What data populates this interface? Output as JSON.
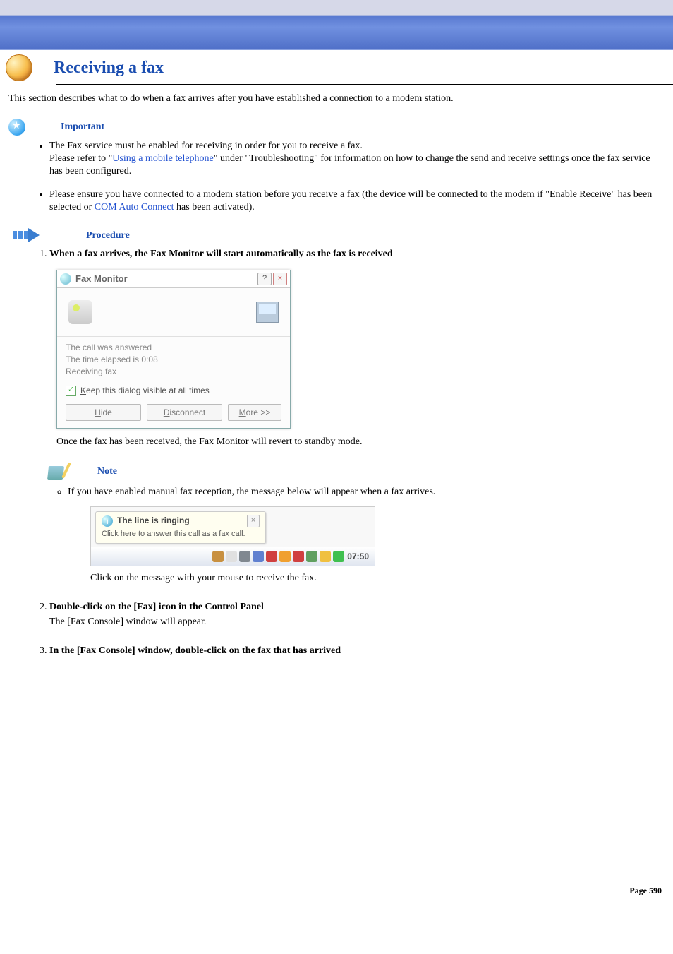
{
  "header": {
    "title": "Receiving a fax"
  },
  "intro": "This section describes what to do when a fax arrives after you have established a connection to a modem station.",
  "important": {
    "label": "Important",
    "items": [
      {
        "pre": "The Fax service must be enabled for receiving in order for you to receive a fax.",
        "line2_a": "Please refer to \"",
        "line2_link": "Using a mobile telephone",
        "line2_b": "\" under \"Troubleshooting\" for information on how to change the send and receive settings once the fax service has been configured."
      },
      {
        "pre": "Please ensure you have connected to a modem station before you receive a fax (the device will be connected to the modem if \"Enable Receive\" has been selected or ",
        "link": "COM Auto Connect",
        "post": " has been activated)."
      }
    ]
  },
  "procedure": {
    "label": "Procedure"
  },
  "steps": [
    {
      "title": "When a fax arrives, the Fax Monitor will start automatically as the fax is received",
      "after": "Once the fax has been received, the Fax Monitor will revert to standby mode."
    },
    {
      "title": "Double-click on the [Fax] icon in the Control Panel",
      "body": "The [Fax Console] window will appear."
    },
    {
      "title": "In the [Fax Console] window, double-click on the fax that has arrived"
    }
  ],
  "fax_monitor": {
    "title": "Fax Monitor",
    "help": "?",
    "close": "×",
    "status1": "The call was answered",
    "status2": "The time elapsed is 0:08",
    "status3": "Receiving fax",
    "keep_prefix": "K",
    "keep_rest": "eep this dialog visible at all times",
    "hide_u": "H",
    "hide_rest": "ide",
    "disc_u": "D",
    "disc_rest": "isconnect",
    "more_u": "M",
    "more_rest": "ore >>"
  },
  "note": {
    "label": "Note",
    "item": "If you have enabled manual fax reception, the message below will appear when a fax arrives.",
    "after": "Click on the message with your mouse to receive the fax."
  },
  "balloon": {
    "title": "The line is ringing",
    "msg": "Click here to answer this call as a fax call.",
    "close": "×",
    "clock": "07:50"
  },
  "tray_icons": [
    "#c89040",
    "#e0e0e0",
    "#808890",
    "#6080d0",
    "#d04040",
    "#f0a030",
    "#d04040",
    "#60a060",
    "#f0c040",
    "#40c050"
  ],
  "page": "Page 590"
}
